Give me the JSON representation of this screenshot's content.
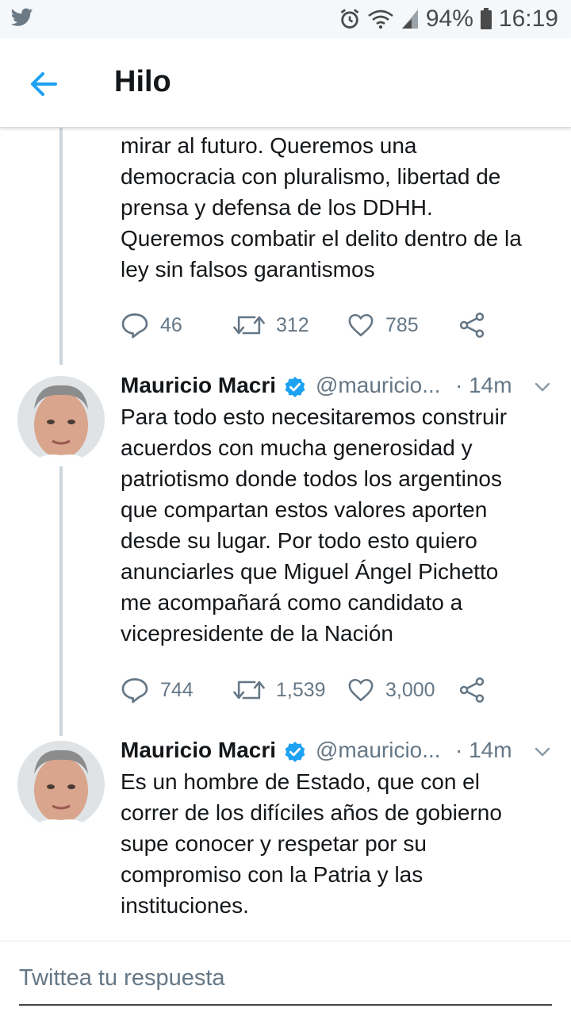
{
  "status_bar": {
    "battery": "94%",
    "time": "16:19",
    "icons": [
      "twitter-bird-icon",
      "alarm-icon",
      "wifi-icon",
      "signal-icon",
      "battery-icon"
    ]
  },
  "header": {
    "title": "Hilo",
    "back_icon": "arrow-left-icon"
  },
  "tweets": [
    {
      "text_lines": [
        "mirar al futuro. Queremos una",
        "democracia con pluralismo, libertad de",
        "prensa y defensa de los DDHH.",
        "Queremos combatir el delito dentro de la",
        "ley sin falsos garantismos"
      ],
      "replies": "46",
      "retweets": "312",
      "likes": "785"
    },
    {
      "name": "Mauricio Macri",
      "handle": "@mauricio...",
      "time": "· 14m",
      "text_lines": [
        "Para todo esto necesitaremos construir",
        "acuerdos con mucha generosidad y",
        "patriotismo donde todos los argentinos",
        "que compartan estos valores aporten",
        "desde su lugar. Por todo esto quiero",
        "anunciarles que Miguel Ángel Pichetto",
        "me acompañará como candidato a",
        "vicepresidente de la Nación"
      ],
      "replies": "744",
      "retweets": "1,539",
      "likes": "3,000"
    },
    {
      "name": "Mauricio Macri",
      "handle": "@mauricio...",
      "time": "· 14m",
      "text_lines": [
        "Es un hombre de Estado, que con el",
        "correr de los difíciles años de gobierno",
        "supe conocer y respetar por su",
        "compromiso con la Patria y las",
        "instituciones."
      ]
    }
  ],
  "reply": {
    "placeholder": "Twittea tu respuesta"
  },
  "colors": {
    "accent": "#1da1f2",
    "verified": "#1da1f2",
    "muted": "#657786",
    "text": "#14171a"
  }
}
